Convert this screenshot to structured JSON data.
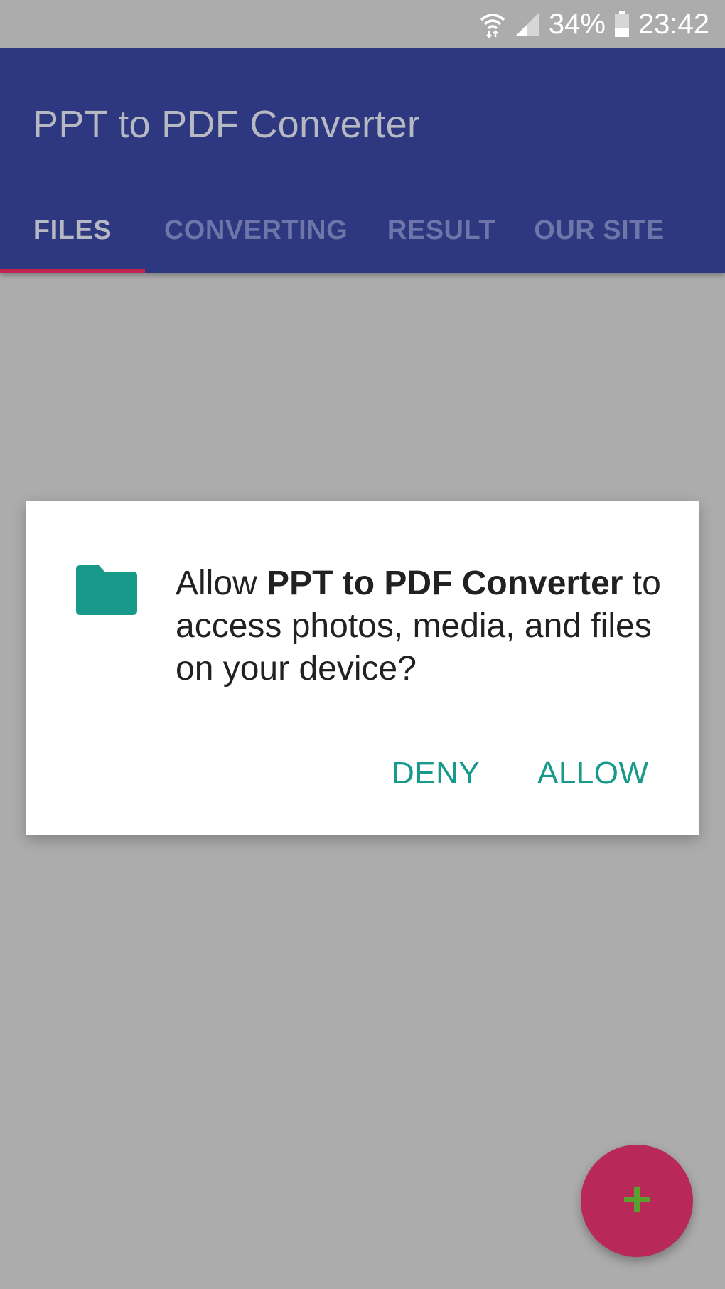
{
  "status_bar": {
    "battery_percent": "34%",
    "time": "23:42",
    "icons": [
      "wifi-icon",
      "signal-icon",
      "battery-icon"
    ]
  },
  "app_bar": {
    "title": "PPT to PDF Converter"
  },
  "tabs": [
    {
      "label": "FILES",
      "active": true
    },
    {
      "label": "CONVERTING",
      "active": false
    },
    {
      "label": "RESULT",
      "active": false
    },
    {
      "label": "OUR SITE",
      "active": false
    }
  ],
  "dialog": {
    "icon": "folder-icon",
    "message_prefix": "Allow ",
    "app_name": "PPT to PDF Converter",
    "message_suffix": " to access photos, media, and files on your device?",
    "deny_label": "DENY",
    "allow_label": "ALLOW"
  },
  "fab": {
    "icon": "plus-icon"
  },
  "colors": {
    "app_bar": "#2d3880",
    "accent": "#c2254f",
    "fab": "#b8295a",
    "dialog_button": "#179a8a",
    "folder_icon": "#179a8a",
    "plus_icon": "#5aa02c",
    "scrim_background": "#acacac"
  }
}
